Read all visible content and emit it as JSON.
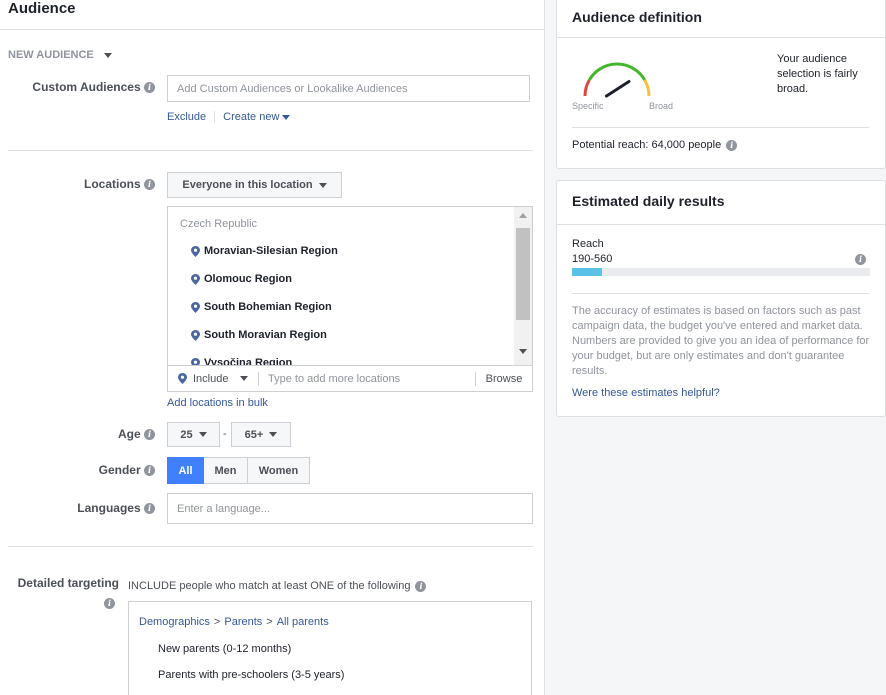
{
  "audience": {
    "title": "Audience",
    "new_audience_label": "NEW AUDIENCE",
    "custom_audiences": {
      "label": "Custom Audiences",
      "placeholder": "Add Custom Audiences or Lookalike Audiences",
      "exclude_link": "Exclude",
      "create_new_link": "Create new"
    },
    "locations": {
      "label": "Locations",
      "dropdown_value": "Everyone in this location",
      "country": "Czech Republic",
      "items": [
        "Moravian-Silesian Region",
        "Olomouc Region",
        "South Bohemian Region",
        "South Moravian Region",
        "Vysočina Region"
      ],
      "include_label": "Include",
      "search_placeholder": "Type to add more locations",
      "browse_label": "Browse",
      "bulk_link": "Add locations in bulk"
    },
    "age": {
      "label": "Age",
      "min": "25",
      "separator": "-",
      "max": "65+"
    },
    "gender": {
      "label": "Gender",
      "options": [
        "All",
        "Men",
        "Women"
      ],
      "selected": "All"
    },
    "languages": {
      "label": "Languages",
      "placeholder": "Enter a language..."
    },
    "detailed_targeting": {
      "label": "Detailed targeting",
      "include_text": "INCLUDE people who match at least ONE of the following",
      "breadcrumb": [
        "Demographics",
        "Parents",
        "All parents"
      ],
      "breadcrumb_sep": ">",
      "items": [
        "New parents (0-12 months)",
        "Parents with pre-schoolers (3-5 years)"
      ]
    }
  },
  "audience_definition": {
    "title": "Audience definition",
    "gauge_specific": "Specific",
    "gauge_broad": "Broad",
    "description": "Your audience selection is fairly broad.",
    "potential_reach": "Potential reach: 64,000 people",
    "gauge_level": 0.8
  },
  "estimated_results": {
    "title": "Estimated daily results",
    "reach_label": "Reach",
    "reach_value": "190-560",
    "reach_fill": 0.1,
    "disclaimer": "The accuracy of estimates is based on factors such as past campaign data, the budget you've entered and market data. Numbers are provided to give you an idea of performance for your budget, but are only estimates and don't guarantee results.",
    "helpful_link": "Were these estimates helpful?"
  },
  "colors": {
    "accent": "#4080ff",
    "link": "#365899",
    "reach_bar": "#5bc2e7"
  }
}
